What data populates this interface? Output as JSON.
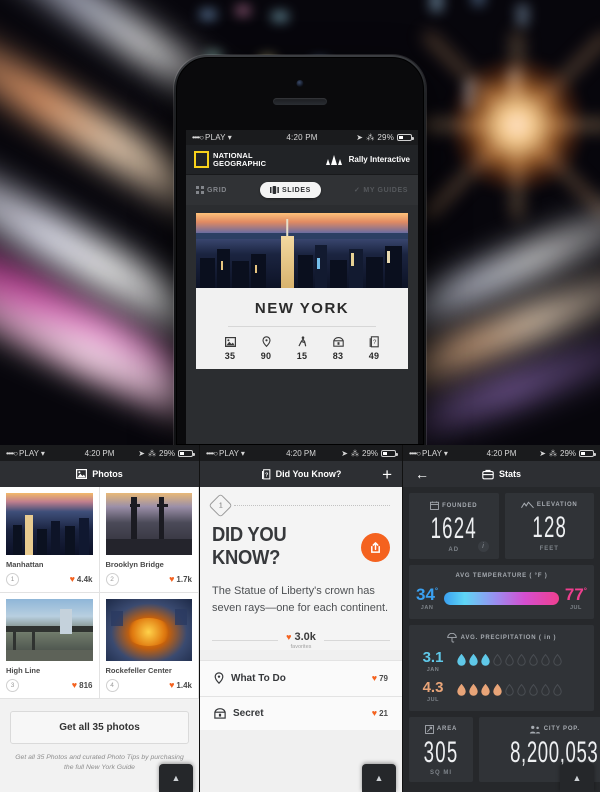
{
  "hero": {
    "status_bar": {
      "carrier": "PLAY",
      "signal_dots": "••••○",
      "time": "4:20 PM",
      "battery": "29%"
    },
    "navbar": {
      "brand_line1": "NATIONAL",
      "brand_line2": "GEOGRAPHIC",
      "partner": "Rally Interactive"
    },
    "segments": [
      {
        "label": "GRID",
        "icon": "grid-icon",
        "active": false
      },
      {
        "label": "SLIDES",
        "icon": "slides-icon",
        "active": true
      },
      {
        "label": "MY GUIDES",
        "icon": "check-icon",
        "active": false
      }
    ],
    "city_card": {
      "name": "NEW YORK",
      "stats": [
        {
          "icon": "photo-icon",
          "value": "35"
        },
        {
          "icon": "pin-icon",
          "value": "90"
        },
        {
          "icon": "walk-icon",
          "value": "15"
        },
        {
          "icon": "chest-icon",
          "value": "83"
        },
        {
          "icon": "card-question-icon",
          "value": "49"
        }
      ]
    }
  },
  "photos_pane": {
    "status_bar": {
      "carrier": "PLAY",
      "signal_dots": "••••○",
      "time": "4:20 PM",
      "battery": "29%"
    },
    "nav_title": "Photos",
    "nav_icon": "photo-icon",
    "items": [
      {
        "index": "1",
        "title": "Manhattan",
        "favorites": "4.4k"
      },
      {
        "index": "2",
        "title": "Brooklyn Bridge",
        "favorites": "1.7k"
      },
      {
        "index": "3",
        "title": "High Line",
        "favorites": "816"
      },
      {
        "index": "4",
        "title": "Rockefeller Center",
        "favorites": "1.4k"
      }
    ],
    "cta_label": "Get all 35 photos",
    "caption": "Get all 35 Photos and curated Photo Tips by purchasing the full New York Guide"
  },
  "dyk_pane": {
    "status_bar": {
      "carrier": "PLAY",
      "signal_dots": "••••○",
      "time": "4:20 PM",
      "battery": "29%"
    },
    "nav_title": "Did You Know?",
    "nav_icon": "card-question-icon",
    "add_label": "+",
    "badge_number": "1",
    "title": "DID YOU KNOW?",
    "share_icon": "share-icon",
    "body": "The Statue of Liberty's crown has seven rays—one for each continent.",
    "favorites_count": "3.0k",
    "favorites_label": "favorites",
    "rows": [
      {
        "icon": "pin-icon",
        "label": "What To Do",
        "count": "79"
      },
      {
        "icon": "chest-icon",
        "label": "Secret",
        "count": "21"
      }
    ]
  },
  "stats_pane": {
    "status_bar": {
      "carrier": "PLAY",
      "signal_dots": "••••○",
      "time": "4:20 PM",
      "battery": "29%"
    },
    "nav_title": "Stats",
    "nav_icon": "briefcase-icon",
    "back_icon": "back-arrow-icon",
    "founded": {
      "header": "FOUNDED",
      "icon": "calendar-icon",
      "value": "1624",
      "unit": "AD"
    },
    "elevation": {
      "header": "ELEVATION",
      "icon": "mountain-icon",
      "value": "128",
      "unit": "FEET"
    },
    "temperature": {
      "header": "AVG TEMPERATURE ( °F )",
      "low": {
        "value": "34",
        "degree": "°",
        "month": "JAN",
        "color": "#3aa0f0"
      },
      "high": {
        "value": "77",
        "degree": "°",
        "month": "JUL",
        "color": "#ef3f8f"
      }
    },
    "precipitation": {
      "header": "AVG. PRECIPITATION ( in )",
      "icon": "umbrella-icon",
      "total_drops": 9,
      "rows": [
        {
          "value": "3.1",
          "month": "JAN",
          "filled": 3,
          "color": "#5fc8e8"
        },
        {
          "value": "4.3",
          "month": "JUL",
          "filled": 4,
          "color": "#e8a478"
        }
      ]
    },
    "area": {
      "header": "AREA",
      "icon": "area-icon",
      "value": "305",
      "unit": "SQ MI"
    },
    "population": {
      "header": "CITY POP.",
      "icon": "people-icon",
      "value": "8,200,053",
      "unit": ""
    }
  },
  "scroll_top_icon": "chevron-up-icon",
  "colors": {
    "accent_orange": "#f4621f",
    "natgeo_yellow": "#f8d11b",
    "dark_chrome": "#2d2f33"
  }
}
